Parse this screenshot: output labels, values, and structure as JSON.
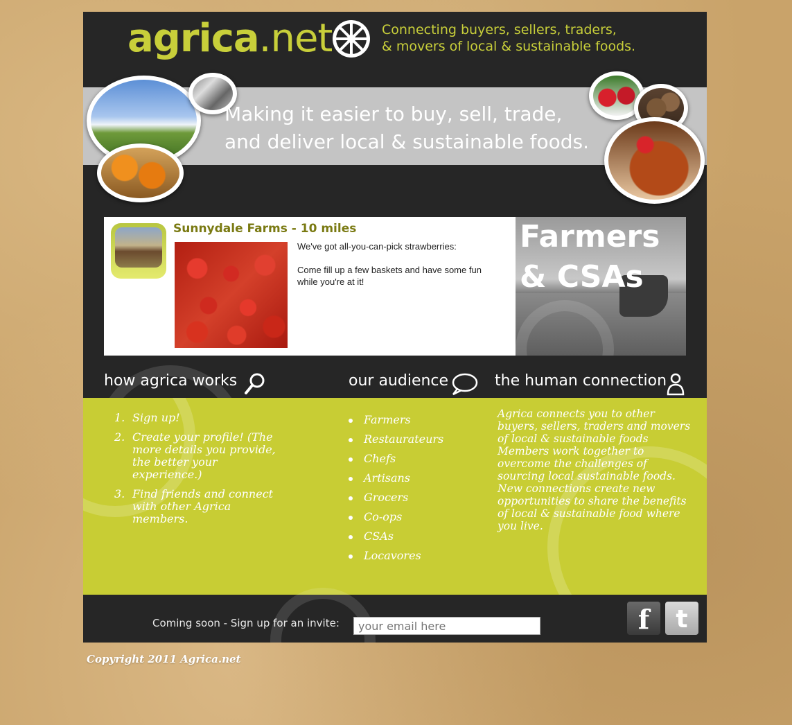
{
  "header": {
    "logo_main": "agrica",
    "logo_suffix": ".net",
    "tagline_line1": "Connecting buyers, sellers, traders,",
    "tagline_line2": "& movers of local & sustainable foods."
  },
  "banner": {
    "line1": "Making it easier to buy, sell, trade,",
    "line2": "and deliver local & sustainable foods."
  },
  "feature": {
    "title": "Sunnydale Farms - 10 miles",
    "message_line1": "We've got all-you-can-pick strawberries:",
    "message_line2": "Come fill up a few baskets and have some fun while you're at it!",
    "category_line1": "Farmers",
    "category_line2": "& CSAs"
  },
  "sections": {
    "how": {
      "heading": "how agrica works",
      "steps": [
        {
          "num": "1.",
          "text": "Sign up!"
        },
        {
          "num": "2.",
          "text": "Create your profile! (The more details you provide, the better your experience.)"
        },
        {
          "num": "3.",
          "text": "Find friends and connect with other Agrica members."
        }
      ]
    },
    "audience": {
      "heading": "our audience",
      "items": [
        "Farmers",
        "Restaurateurs",
        "Chefs",
        "Artisans",
        "Grocers",
        "Co-ops",
        "CSAs",
        "Locavores"
      ]
    },
    "human": {
      "heading": "the human connection",
      "text": "Agrica connects you to other buyers, sellers, traders and movers of local & sustainable foods Members work together to overcome the challenges of sourcing local sustainable foods. New connections create new opportunities to share the benefits of local & sustainable food where you live."
    }
  },
  "footer": {
    "signup_label": "Coming soon - Sign up for an invite:",
    "email_placeholder": "your email here",
    "facebook_glyph": "f",
    "twitter_glyph": "t",
    "copyright": "Copyright 2011 Agrica.net"
  },
  "colors": {
    "brand_green": "#c8cd34",
    "dark_bg": "#262626",
    "banner_gray": "#c4c4c4"
  }
}
